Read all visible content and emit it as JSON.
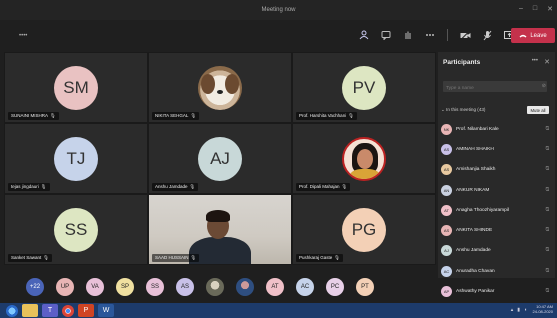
{
  "window": {
    "title": "Meeting now",
    "controls": [
      "–",
      "□",
      "✕"
    ]
  },
  "toolbar": {
    "timer": "••••",
    "icons": [
      "people-icon",
      "chat-icon",
      "raise-hand-icon",
      "more-icon",
      "camera-icon",
      "mic-icon",
      "share-icon"
    ],
    "leave_label": "Leave",
    "leave_color": "#c4314b"
  },
  "tiles": [
    {
      "initials": "SM",
      "name": "SUNAINI MISHRA",
      "color": "#e9c2c2",
      "kind": "initials"
    },
    {
      "initials": "",
      "name": "NIKITA SEHGAL",
      "color": "#f2ece2",
      "kind": "dog"
    },
    {
      "initials": "PV",
      "name": "Prof. Harshita Vachhani",
      "color": "#dde6c2",
      "kind": "initials"
    },
    {
      "initials": "TJ",
      "name": "tejas jingdauri",
      "color": "#c6d3ea",
      "kind": "initials"
    },
    {
      "initials": "AJ",
      "name": "Anshu Jamdade",
      "color": "#c8d8d8",
      "kind": "initials"
    },
    {
      "initials": "",
      "name": "Prof. Dipali Mahajan",
      "color": "#f5e0d4",
      "kind": "woman"
    },
    {
      "initials": "SS",
      "name": "Sanket Sawant",
      "color": "#dde6c2",
      "kind": "initials"
    },
    {
      "initials": "",
      "name": "SAAD HUSSAIN",
      "color": "#d7d4cf",
      "kind": "video"
    },
    {
      "initials": "PG",
      "name": "Pushkaraj Gaste",
      "color": "#f3d0b6",
      "kind": "initials"
    }
  ],
  "panel": {
    "title": "Participants",
    "more": "•••",
    "close": "✕",
    "search_placeholder": "Type a name",
    "in_meeting_label": "In this meeting (43)",
    "mute_all_label": "Mute all",
    "participants": [
      {
        "name": "Prof. Nilambari Kale",
        "initials": "NK",
        "color": "#e8b5b5"
      },
      {
        "name": "AMINAH SHAIKH",
        "initials": "AS",
        "color": "#c8c0e8"
      },
      {
        "name": "Amishanjia Shaikh",
        "initials": "AS",
        "color": "#e8c9a0"
      },
      {
        "name": "ANKUR NIKAM",
        "initials": "AN",
        "color": "#c9d0e0"
      },
      {
        "name": "Anagha Thoozhiyarampil",
        "initials": "AT",
        "color": "#f0c0c8"
      },
      {
        "name": "ANKITA SHINDE",
        "initials": "AS",
        "color": "#e8b5b5"
      },
      {
        "name": "Anshu Jamdade",
        "initials": "AJ",
        "color": "#c8d8d8"
      },
      {
        "name": "Anuradha Chavan",
        "initials": "AC",
        "color": "#c6d3ea"
      },
      {
        "name": "Ashwathy Panikar",
        "initials": "AP",
        "color": "#e8c0d8"
      }
    ]
  },
  "bottom_row": [
    {
      "label": "+22",
      "color": "#4a64b8",
      "text_color": "#fff"
    },
    {
      "label": "UP",
      "color": "#e8b5b5",
      "text_color": "#333"
    },
    {
      "label": "VA",
      "color": "#e8c0d8",
      "text_color": "#333"
    },
    {
      "label": "SP",
      "color": "#f0e0a0",
      "text_color": "#333"
    },
    {
      "label": "SS",
      "color": "#e8c0d8",
      "text_color": "#333"
    },
    {
      "label": "AS",
      "color": "#c8c0e8",
      "text_color": "#333"
    },
    {
      "label": "",
      "color": "#8a8a7a",
      "text_color": "#333"
    },
    {
      "label": "",
      "color": "#5a7aa8",
      "text_color": "#333"
    },
    {
      "label": "AT",
      "color": "#f0c0c8",
      "text_color": "#333"
    },
    {
      "label": "AC",
      "color": "#c6d3ea",
      "text_color": "#333"
    },
    {
      "label": "PC",
      "color": "#e8d0e8",
      "text_color": "#333"
    },
    {
      "label": "PT",
      "color": "#f3d0b6",
      "text_color": "#333"
    }
  ],
  "taskbar": {
    "apps": [
      "start-icon",
      "explorer-icon",
      "teams-icon",
      "chrome-icon",
      "powerpoint-icon",
      "word-icon"
    ],
    "time": "10:47 AM",
    "date": "24-08-2020"
  }
}
